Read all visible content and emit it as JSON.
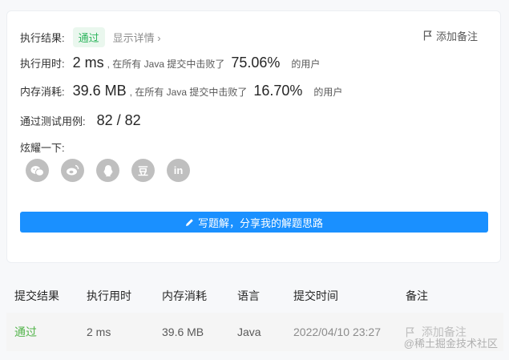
{
  "summary": {
    "result_label": "执行结果:",
    "status": "通过",
    "detail_link": "显示详情 ›",
    "add_note": "添加备注"
  },
  "runtime": {
    "label": "执行用时:",
    "value": "2 ms",
    "mid_text": ", 在所有 Java 提交中击败了",
    "percent": "75.06%",
    "suffix": "的用户"
  },
  "memory": {
    "label": "内存消耗:",
    "value": "39.6 MB",
    "mid_text": ", 在所有 Java 提交中击败了",
    "percent": "16.70%",
    "suffix": "的用户"
  },
  "tests": {
    "label": "通过测试用例:",
    "value": "82 / 82"
  },
  "share": {
    "label": "炫耀一下:",
    "icons": [
      "wechat-icon",
      "weibo-icon",
      "qq-icon",
      "douban-icon",
      "linkedin-icon"
    ],
    "douban_glyph": "豆",
    "linkedin_glyph": "in"
  },
  "cta": {
    "label": "写题解，分享我的解题思路"
  },
  "table": {
    "headers": [
      "提交结果",
      "执行用时",
      "内存消耗",
      "语言",
      "提交时间",
      "备注"
    ],
    "row": {
      "result": "通过",
      "runtime": "2 ms",
      "memory": "39.6 MB",
      "language": "Java",
      "time": "2022/04/10 23:27",
      "note": "添加备注"
    }
  },
  "watermark": "@稀土掘金技术社区",
  "colors": {
    "accent": "#1a90ff",
    "success": "#2db55d",
    "icon_gray": "#bfbfbf"
  }
}
